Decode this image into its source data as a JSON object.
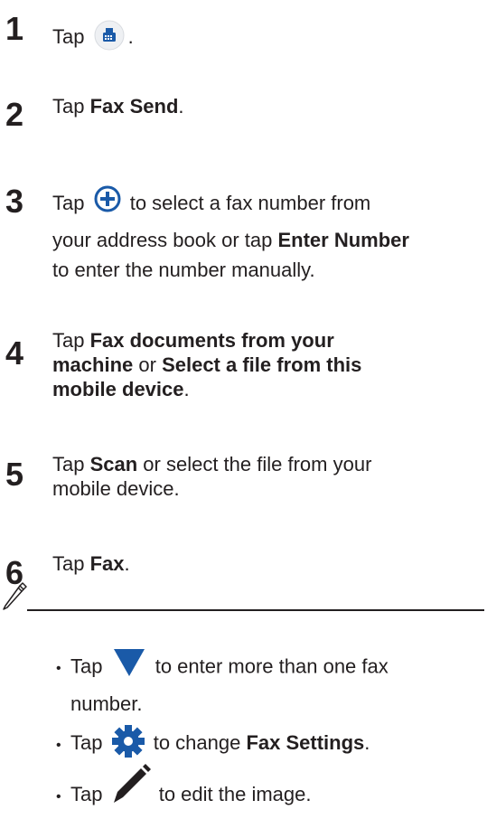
{
  "steps": [
    {
      "n": "1",
      "pre": "Tap ",
      "post": "."
    },
    {
      "n": "2",
      "pre": "Tap ",
      "bold": "Fax Send",
      "post": "."
    },
    {
      "n": "3",
      "pre": "Tap ",
      "mid": " to select a fax number from",
      "line2a": "your address book or tap ",
      "bold": "Enter Number",
      "line3": "to enter the number manually."
    },
    {
      "n": "4",
      "pre": "Tap ",
      "bold1": "Fax documents from your",
      "bold1b": "machine",
      "mid": " or ",
      "bold2": "Select a file from this",
      "bold2b": "mobile device",
      "post": "."
    },
    {
      "n": "5",
      "pre": "Tap ",
      "bold": "Scan",
      "post": " or select the file from your",
      "line2": "mobile device."
    },
    {
      "n": "6",
      "pre": "Tap ",
      "bold": "Fax",
      "post": "."
    }
  ],
  "notes": [
    {
      "pre": "Tap ",
      "post": " to enter more than one fax",
      "line2": "number."
    },
    {
      "pre": "Tap ",
      "post": " to change ",
      "bold": "Fax Settings",
      "end": "."
    },
    {
      "pre": "Tap ",
      "post": " to edit the image."
    }
  ],
  "bullet": "•",
  "icons": {
    "fax_app": "fax-app-icon",
    "add": "plus-circle-icon",
    "dropdown": "triangle-down-icon",
    "settings": "gear-icon",
    "edit": "pencil-icon",
    "note": "pencil-note-icon"
  },
  "colors": {
    "text": "#231f20",
    "accent_blue": "#1a5aa8"
  }
}
